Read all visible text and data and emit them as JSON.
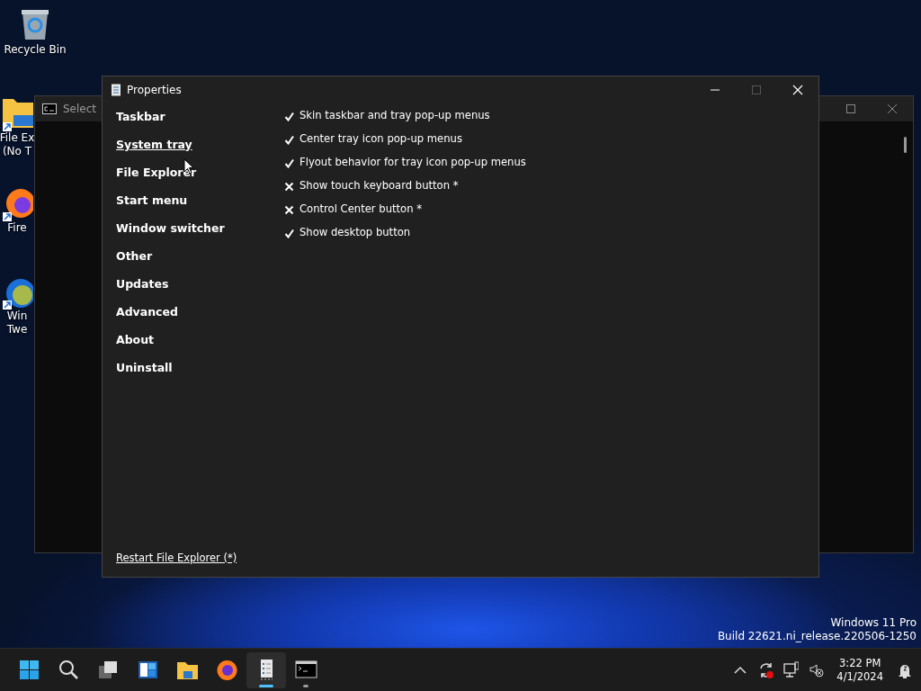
{
  "desktop_icons": [
    {
      "kind": "recycle",
      "lines": [
        "Recycle Bin"
      ]
    },
    {
      "kind": "folder",
      "lines": [
        "File Ex",
        "(No T"
      ]
    },
    {
      "kind": "browser",
      "lines": [
        "Fire"
      ]
    },
    {
      "kind": "tweaker",
      "lines": [
        "Win",
        "Twe"
      ]
    }
  ],
  "console_window": {
    "title": "Select"
  },
  "properties_window": {
    "title": "Properties",
    "sidebar": [
      {
        "label": "Taskbar",
        "selected": false
      },
      {
        "label": "System tray",
        "selected": true
      },
      {
        "label": "File Explorer",
        "selected": false
      },
      {
        "label": "Start menu",
        "selected": false
      },
      {
        "label": "Window switcher",
        "selected": false
      },
      {
        "label": "Other",
        "selected": false
      },
      {
        "label": "Updates",
        "selected": false
      },
      {
        "label": "Advanced",
        "selected": false
      },
      {
        "label": "About",
        "selected": false
      },
      {
        "label": "Uninstall",
        "selected": false
      }
    ],
    "options": [
      {
        "label": "Skin taskbar and tray pop-up menus",
        "checked": true
      },
      {
        "label": "Center tray icon pop-up menus",
        "checked": true
      },
      {
        "label": "Flyout behavior for tray icon pop-up menus",
        "checked": true
      },
      {
        "label": "Show touch keyboard button *",
        "checked": false
      },
      {
        "label": "Control Center button *",
        "checked": false
      },
      {
        "label": "Show desktop button",
        "checked": true
      }
    ],
    "footer_link": "Restart File Explorer (*)"
  },
  "os_watermark": {
    "edition": "Windows 11 Pro",
    "build": "Build 22621.ni_release.220506-1250"
  },
  "taskbar": {
    "apps": [
      {
        "kind": "start",
        "running": false,
        "selected": false
      },
      {
        "kind": "search",
        "running": false,
        "selected": false
      },
      {
        "kind": "taskview",
        "running": false,
        "selected": false
      },
      {
        "kind": "widgets",
        "running": false,
        "selected": false
      },
      {
        "kind": "explorer",
        "running": false,
        "selected": false
      },
      {
        "kind": "firefox",
        "running": false,
        "selected": false
      },
      {
        "kind": "properties",
        "running": true,
        "selected": true
      },
      {
        "kind": "terminal",
        "running": true,
        "selected": false
      }
    ],
    "clock": {
      "time": "3:22 PM",
      "date": "4/1/2024"
    }
  }
}
